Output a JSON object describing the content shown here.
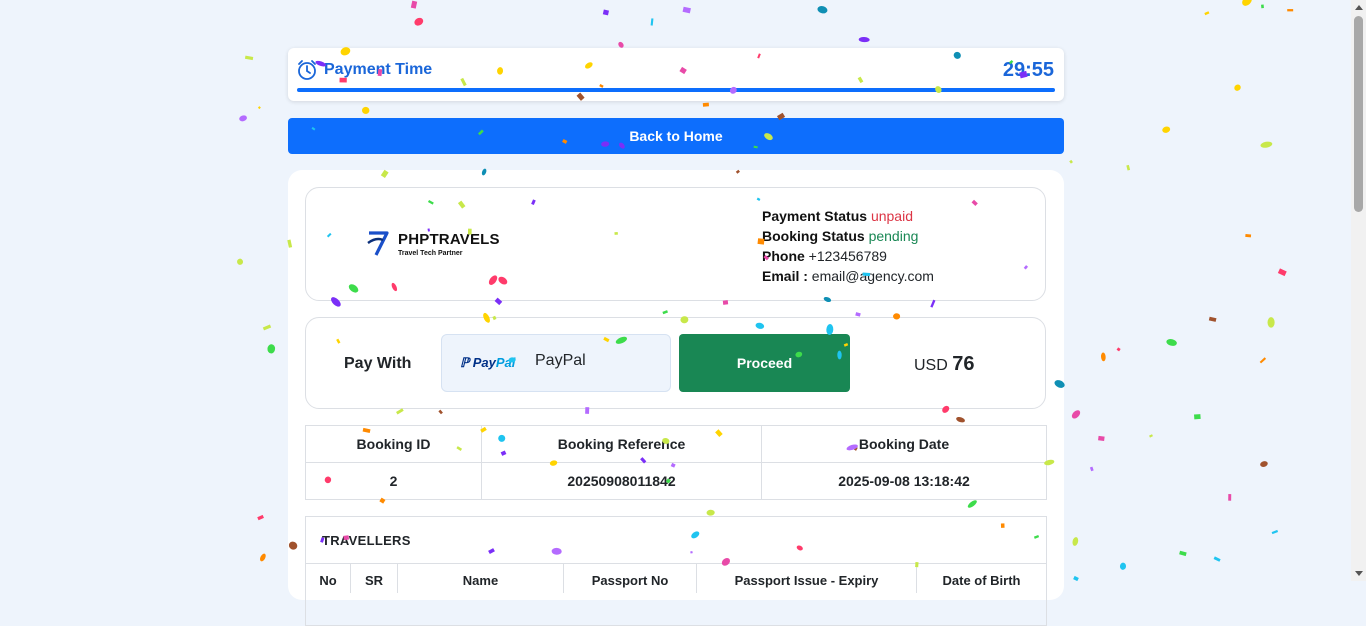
{
  "timer": {
    "title": "Payment Time",
    "countdown": "29:55",
    "progress": 1.0
  },
  "nav": {
    "back_label": "Back to Home"
  },
  "brand": {
    "name": "PHPTRAVELS",
    "tagline": "Travel Tech Partner"
  },
  "status": {
    "payment_label": "Payment Status",
    "payment_value": "unpaid",
    "booking_label": "Booking Status",
    "booking_value": "pending",
    "phone_label": "Phone",
    "phone_value": "+123456789",
    "email_label": "Email :",
    "email_value": "email@agency.com"
  },
  "payment": {
    "pay_with_label": "Pay With",
    "method_logo_a": "Pay",
    "method_logo_b": "Pal",
    "method_label": "PayPal",
    "proceed_label": "Proceed",
    "currency": "USD",
    "amount": "76"
  },
  "booking": {
    "headers": [
      "Booking ID",
      "Booking Reference",
      "Booking Date"
    ],
    "row": [
      "2",
      "20250908011842",
      "2025-09-08 13:18:42"
    ]
  },
  "travellers": {
    "title": "TRAVELLERS",
    "columns": [
      "No",
      "SR",
      "Name",
      "Passport No",
      "Passport Issue - Expiry",
      "Date of Birth"
    ]
  },
  "colors": {
    "accent": "#0d6efd",
    "proceed": "#198754",
    "unpaid": "#dc3545",
    "pending": "#198754"
  }
}
